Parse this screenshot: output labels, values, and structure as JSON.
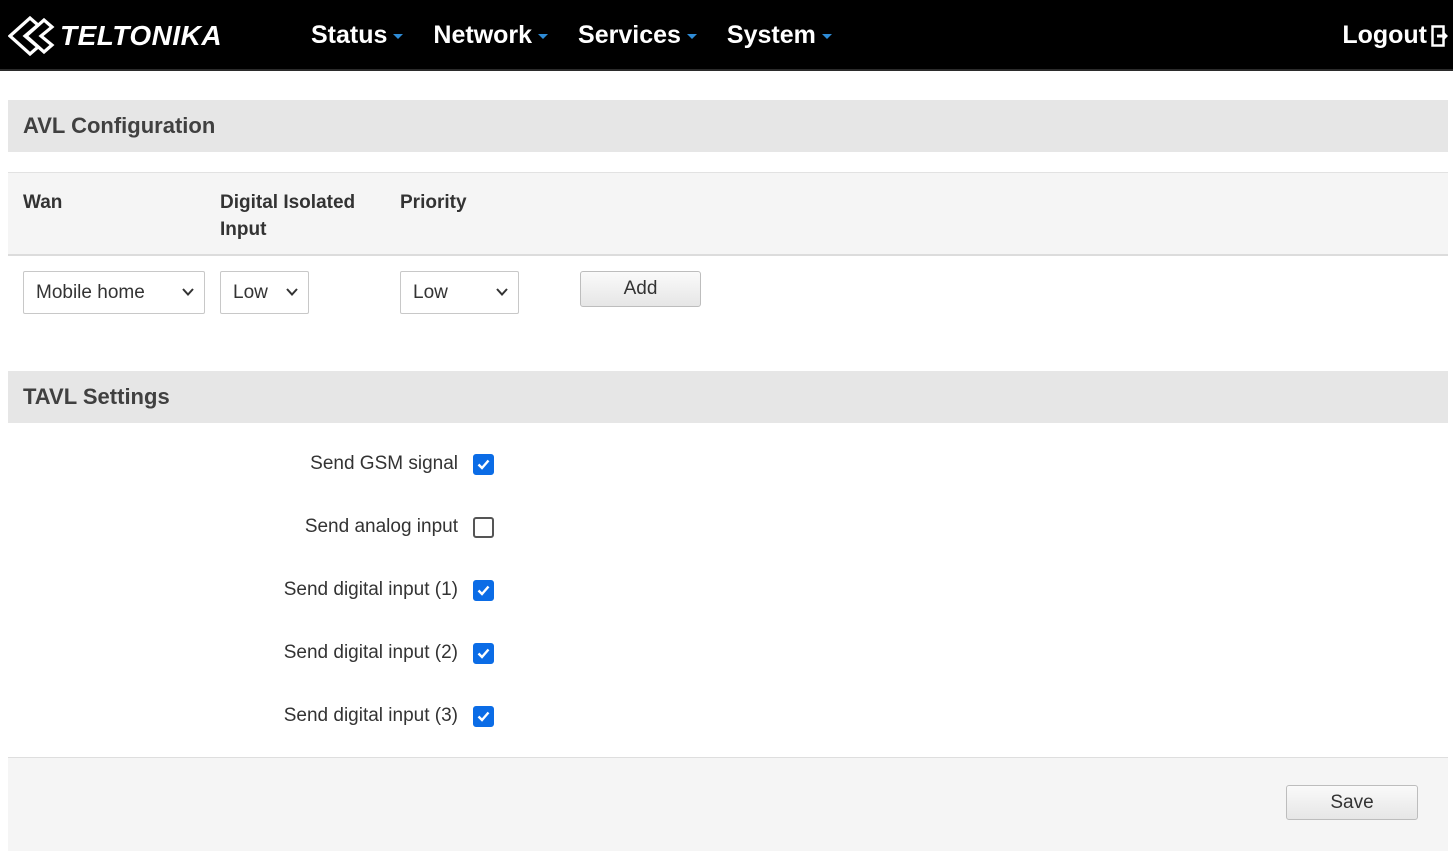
{
  "brand": {
    "name": "TELTONIKA"
  },
  "nav": {
    "items": [
      {
        "label": "Status"
      },
      {
        "label": "Network"
      },
      {
        "label": "Services"
      },
      {
        "label": "System"
      }
    ],
    "logout": "Logout",
    "caret_color": "#2e8bd6"
  },
  "avl": {
    "title": "AVL Configuration",
    "columns": {
      "wan": "Wan",
      "input_line1": "Digital Isolated",
      "input_line2": "Input",
      "priority": "Priority"
    },
    "row": {
      "wan": "Mobile home",
      "input": "Low",
      "priority": "Low"
    },
    "add_label": "Add"
  },
  "tavl": {
    "title": "TAVL Settings",
    "options": [
      {
        "label": "Send GSM signal",
        "checked": true
      },
      {
        "label": "Send analog input",
        "checked": false
      },
      {
        "label": "Send digital input (1)",
        "checked": true
      },
      {
        "label": "Send digital input (2)",
        "checked": true
      },
      {
        "label": "Send digital input (3)",
        "checked": true
      }
    ]
  },
  "footer": {
    "save_label": "Save"
  },
  "colors": {
    "accent": "#0b6ce6",
    "topbar": "#000000",
    "section_bg": "#e6e6e6"
  }
}
